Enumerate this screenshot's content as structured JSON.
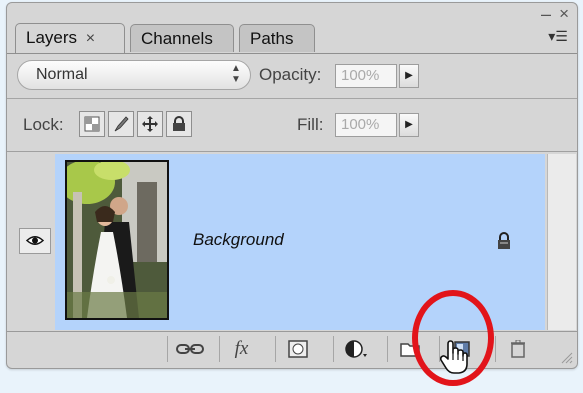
{
  "window": {
    "minimize_glyph": "–",
    "close_glyph": "×",
    "panel_menu_glyph": "▾☰"
  },
  "tabs": [
    {
      "label": "Layers",
      "active": true,
      "close": "×"
    },
    {
      "label": "Channels",
      "active": false
    },
    {
      "label": "Paths",
      "active": false
    }
  ],
  "blend": {
    "mode": "Normal",
    "opacity_label": "Opacity:",
    "opacity_value": "100%"
  },
  "lock": {
    "label": "Lock:",
    "fill_label": "Fill:",
    "fill_value": "100%",
    "icons": [
      "lock-transparent-pixels-icon",
      "lock-image-pixels-icon",
      "lock-position-icon",
      "lock-all-icon"
    ]
  },
  "layers": [
    {
      "name": "Background",
      "visible": true,
      "locked": true
    }
  ],
  "colors": {
    "selection": "#b4d3fb",
    "highlight_circle": "#e2141a"
  },
  "bottom_icons": [
    "link-layers-icon",
    "layer-style-fx-icon",
    "add-mask-icon",
    "adjustment-layer-icon",
    "new-group-icon",
    "new-layer-icon",
    "delete-layer-icon"
  ],
  "fx_label": "fx"
}
